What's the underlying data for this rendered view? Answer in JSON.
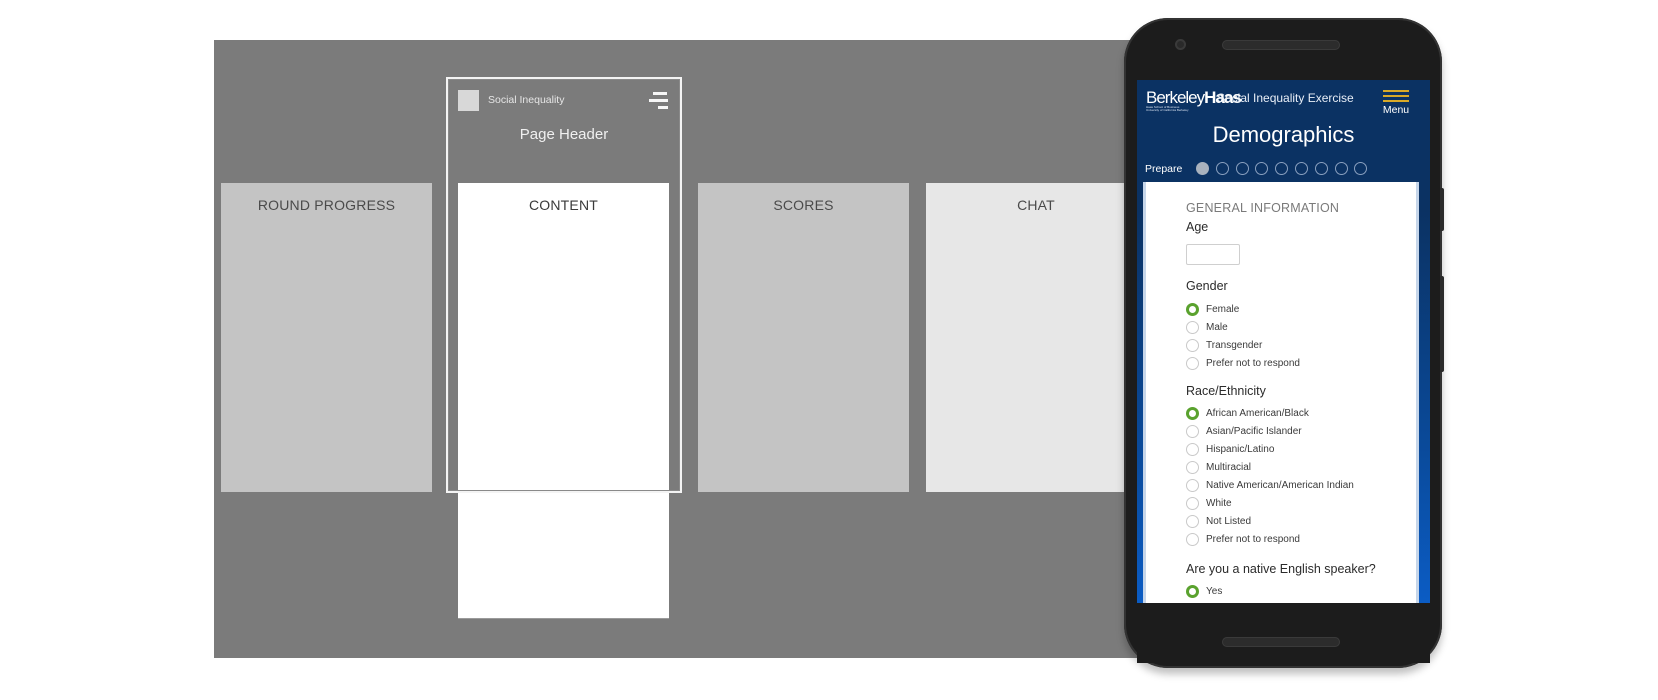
{
  "wireframe": {
    "app_title": "Social Inequality",
    "page_header": "Page Header",
    "panels": {
      "round_progress": "ROUND PROGRESS",
      "content": "CONTENT",
      "scores": "SCORES",
      "chat": "CHAT"
    }
  },
  "phone": {
    "logo": {
      "part1": "Berkeley",
      "part2": "Haas",
      "sub1": "Haas School of Business",
      "sub2": "University of California Berkeley"
    },
    "app_title": "Social Inequality Exercise",
    "menu_label": "Menu",
    "page_heading": "Demographics",
    "progress": {
      "label": "Prepare",
      "total_steps": 9,
      "completed_steps": 1
    },
    "form": {
      "section_title": "GENERAL INFORMATION",
      "age": {
        "label": "Age",
        "value": ""
      },
      "gender": {
        "label": "Gender",
        "selected": "Female",
        "options": [
          "Female",
          "Male",
          "Transgender",
          "Prefer not to respond"
        ]
      },
      "race": {
        "label": "Race/Ethnicity",
        "selected": "African American/Black",
        "options": [
          "African American/Black",
          "Asian/Pacific Islander",
          "Hispanic/Latino",
          "Multiracial",
          "Native American/American Indian",
          "White",
          "Not Listed",
          "Prefer not to respond"
        ]
      },
      "english": {
        "label": "Are you a native English speaker?",
        "selected": "Yes",
        "options": [
          "Yes"
        ]
      }
    },
    "colors": {
      "header_navy": "#0b3263",
      "accent_gold": "#d8a928",
      "radio_selected_green": "#5aa22e"
    }
  }
}
